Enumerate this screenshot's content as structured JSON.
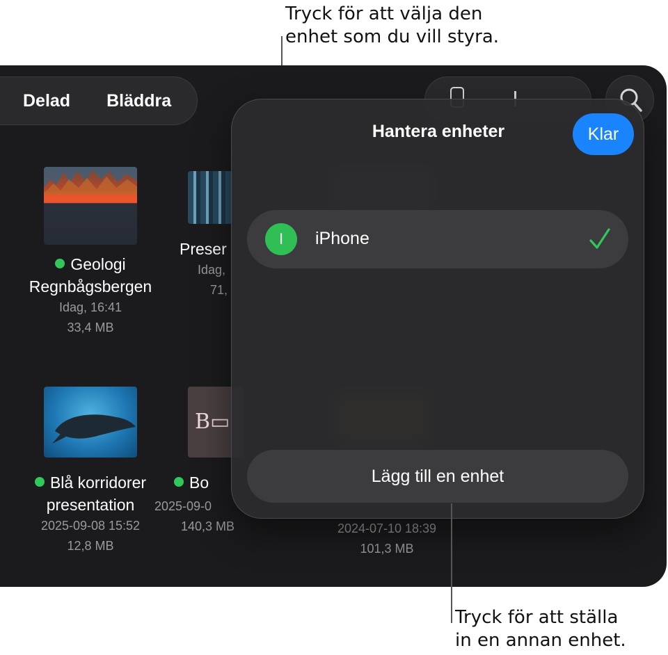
{
  "callouts": {
    "top_line1": "Tryck för att välja den",
    "top_line2": "enhet som du vill styra.",
    "bottom_line1": "Tryck för att ställa",
    "bottom_line2": "in en annan enhet."
  },
  "nav": {
    "shared": "Delad",
    "browse": "Bläddra"
  },
  "files": [
    {
      "name_line1": "Geologi",
      "name_line2": "Regnbågsbergen",
      "date": "Idag, 16:41",
      "size": "33,4 MB",
      "synced": true
    },
    {
      "name_line1": "Preser",
      "date": "Idag,",
      "size": "71,"
    },
    {
      "name_line1": "Blå korridorer",
      "name_line2": "presentation",
      "date": "2025-09-08 15:52",
      "size": "12,8 MB",
      "synced": true
    },
    {
      "name_line1": "Bo",
      "date": "2025-09-0",
      "size": "140,3 MB",
      "synced": true
    },
    {
      "date": "2024-07-10 18:39",
      "size": "101,3 MB"
    }
  ],
  "panel": {
    "title": "Hantera enheter",
    "done": "Klar",
    "device": {
      "initial": "I",
      "name": "iPhone",
      "selected": true
    },
    "add_device": "Lägg till en enhet"
  },
  "colors": {
    "accent": "#1a84ff",
    "status_green": "#32c759",
    "background": "#1b1b1d"
  }
}
